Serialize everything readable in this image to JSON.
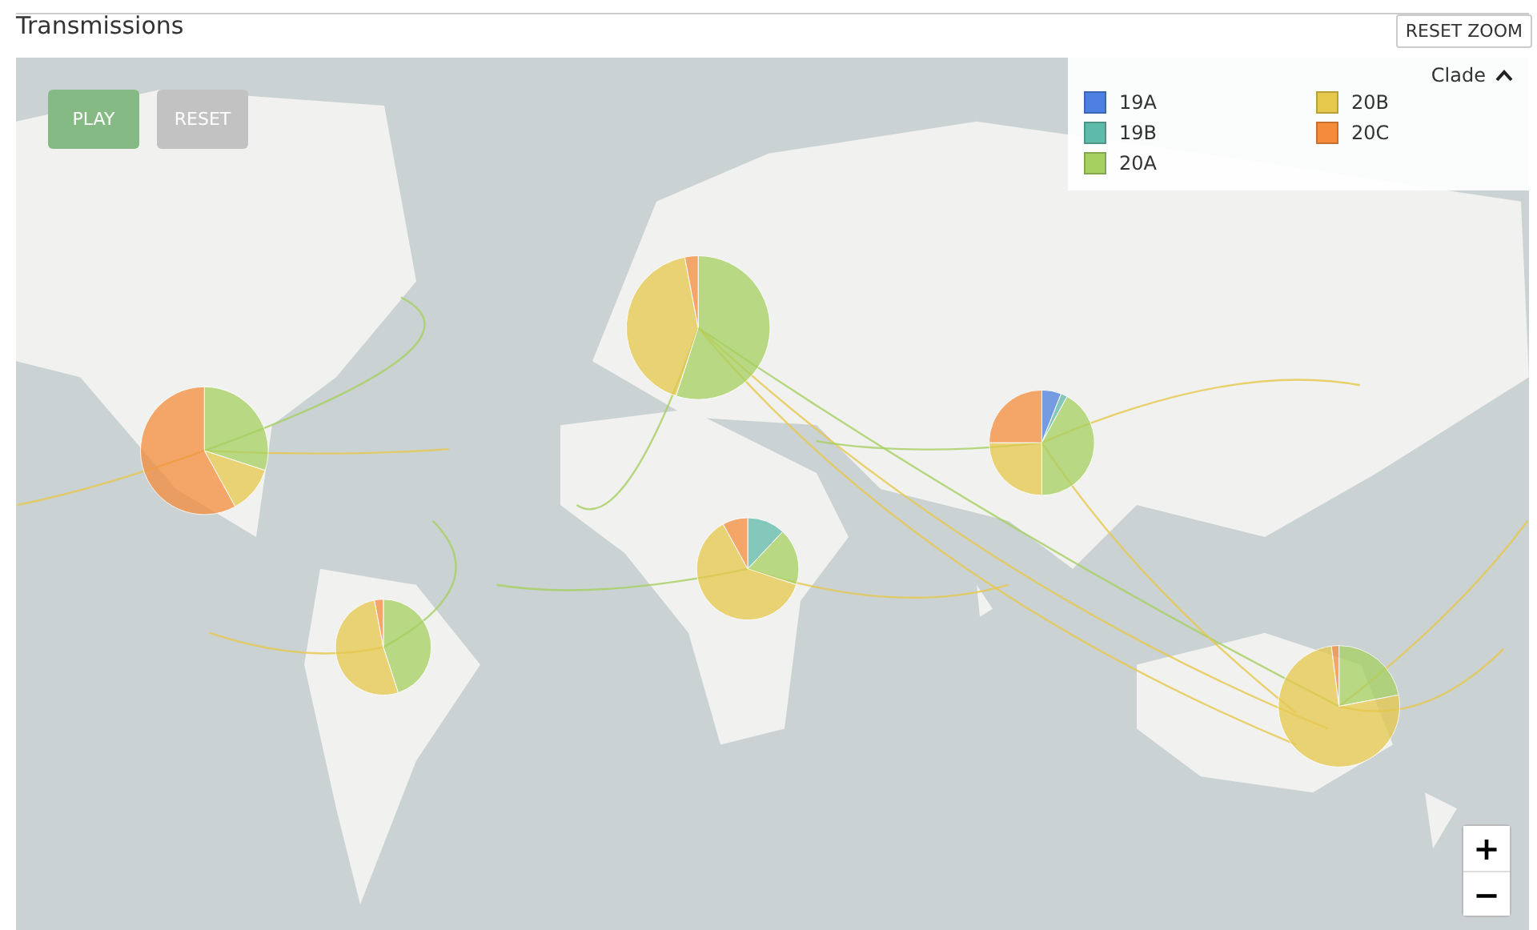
{
  "header": {
    "title": "Transmissions",
    "reset_zoom": "RESET ZOOM"
  },
  "map": {
    "kind": "picture",
    "play": "PLAY",
    "reset": "RESET",
    "zoom_in": "+",
    "zoom_out": "−"
  },
  "legend": {
    "title": "Clade",
    "expanded": true,
    "items": [
      {
        "label": "19A",
        "color": "#4c7fe0"
      },
      {
        "label": "19B",
        "color": "#5fbba9"
      },
      {
        "label": "20A",
        "color": "#a6d060"
      },
      {
        "label": "20B",
        "color": "#e6c84c"
      },
      {
        "label": "20C",
        "color": "#f58c3c"
      }
    ]
  }
}
